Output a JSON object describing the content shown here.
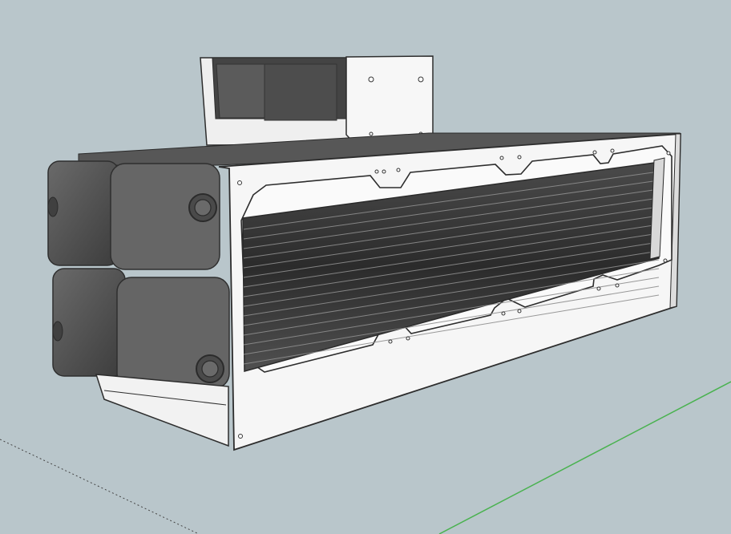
{
  "scene": {
    "background": "#b9c6cb",
    "panel_color": "#f4f4f4",
    "panel_edge": "#2d2d2d",
    "fan_color": "#555555",
    "fin_dark": "#2c2c2c",
    "fin_light": "#8d8d8d",
    "axis_green": "#49b24f",
    "axis_dashed": "#3b3b3b"
  },
  "objects": {
    "top_fan_unit": "top-fan-shroud",
    "radiator_body": "radiator-core",
    "side_fans": "side-fan-modules",
    "mount_frame": "mounting-plate"
  }
}
